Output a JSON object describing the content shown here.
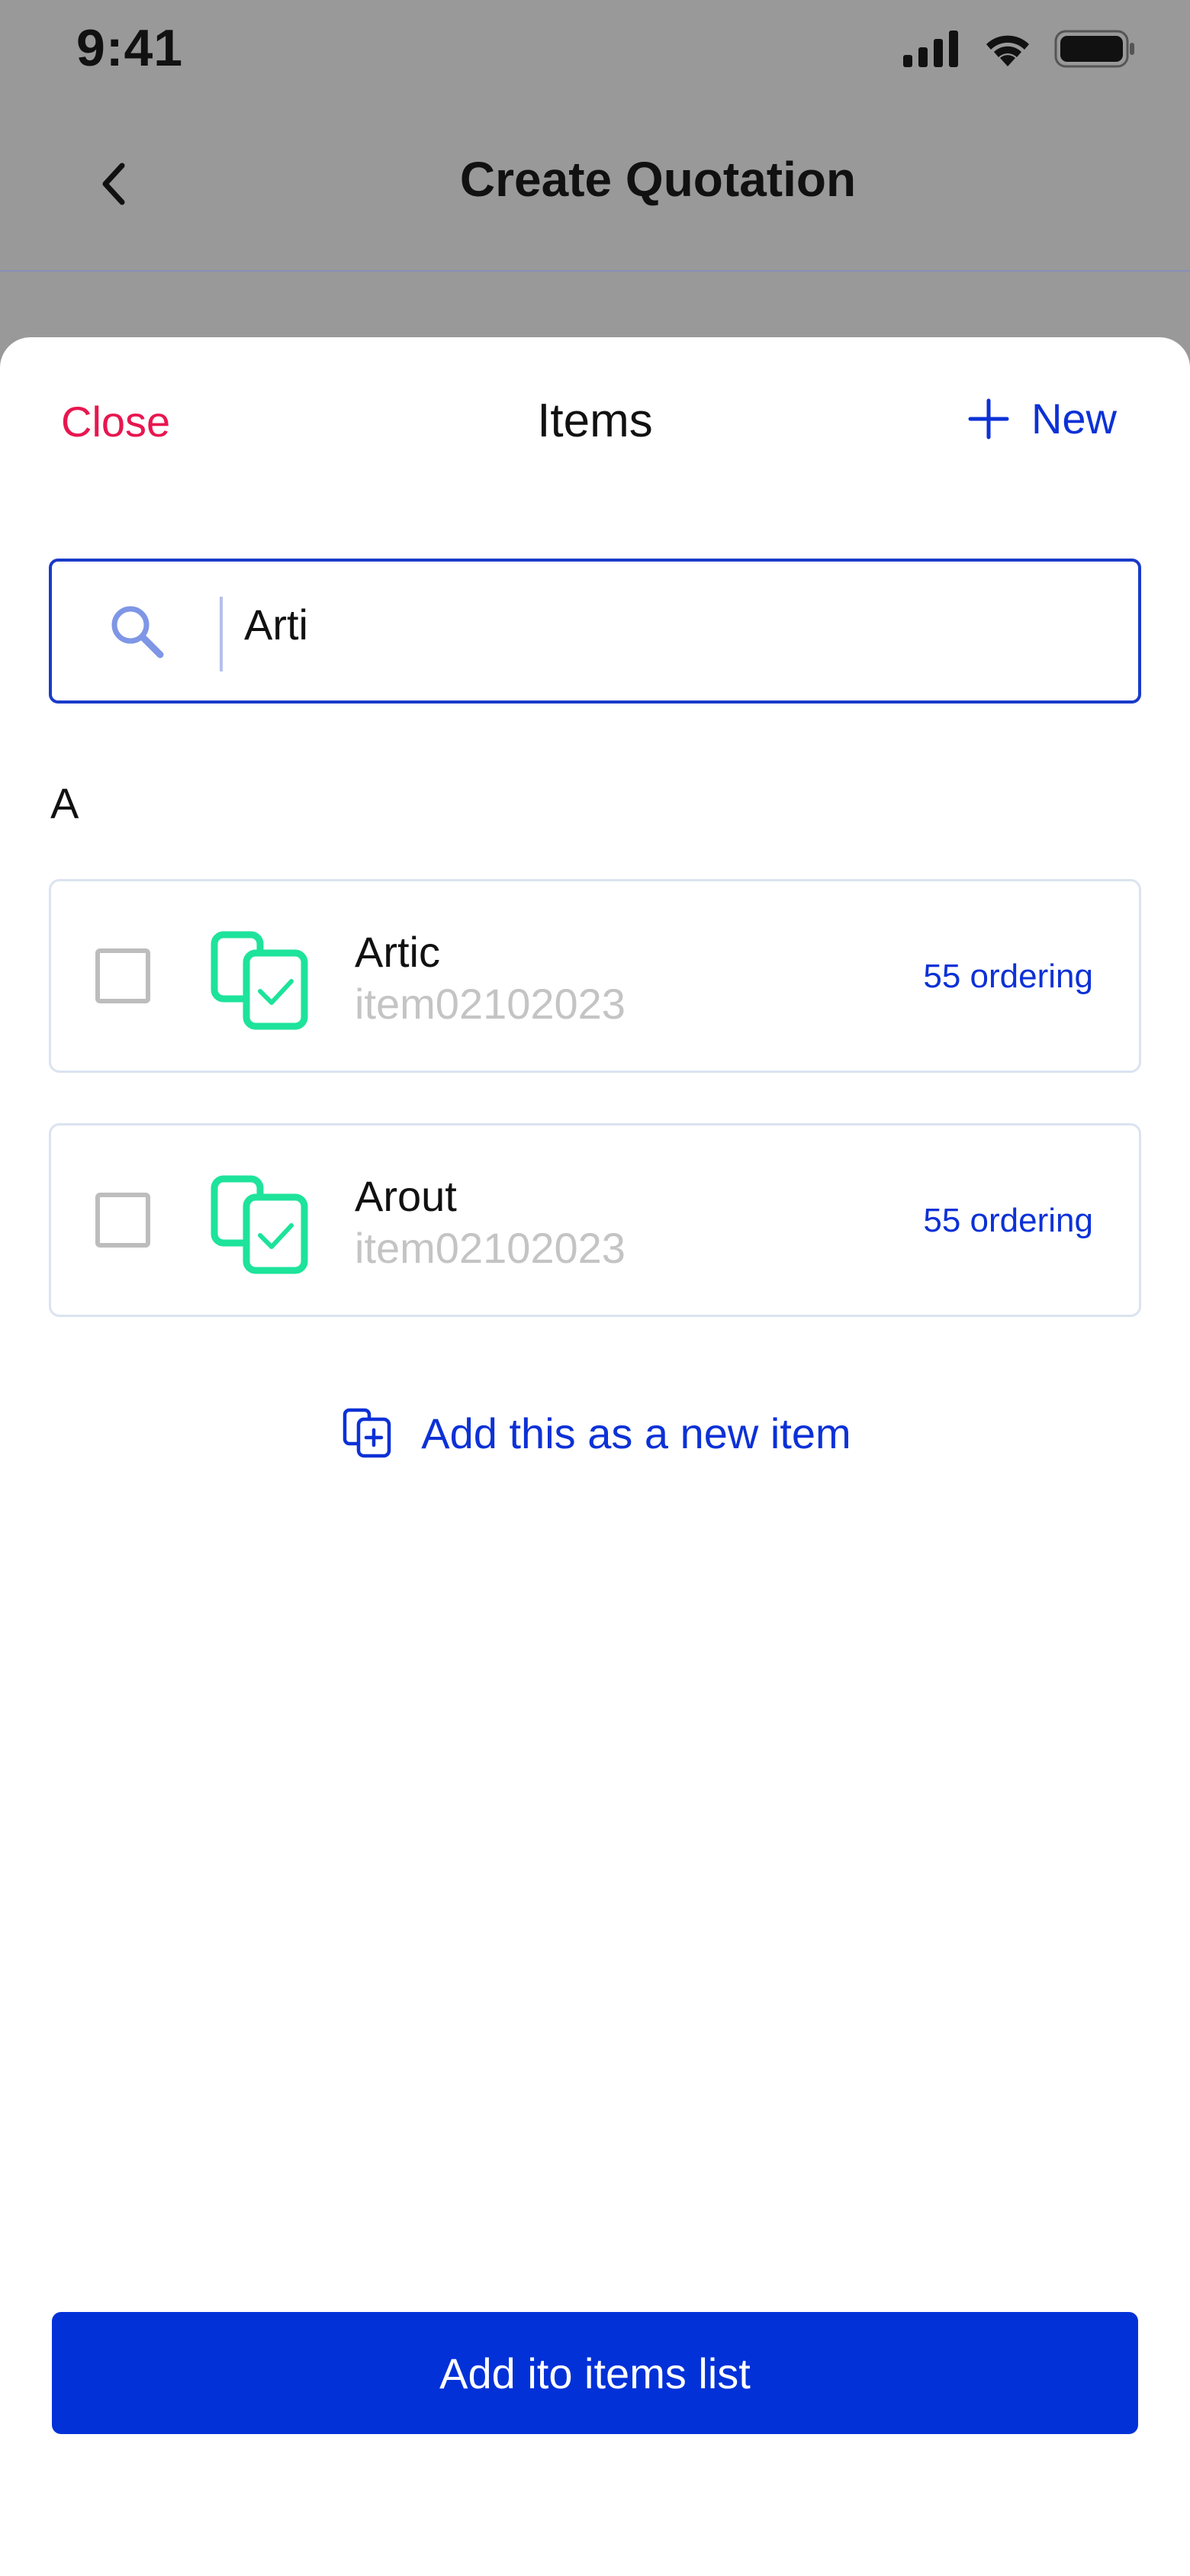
{
  "status_bar": {
    "time": "9:41"
  },
  "nav": {
    "title": "Create Quotation"
  },
  "sheet": {
    "close_label": "Close",
    "title": "Items",
    "new_label": "New",
    "search": {
      "value": "Arti"
    },
    "section_letter": "A",
    "items": [
      {
        "name": "Artic",
        "code": "item02102023",
        "meta": "55 ordering",
        "checked": false
      },
      {
        "name": "Arout",
        "code": "item02102023",
        "meta": "55 ordering",
        "checked": false
      }
    ],
    "add_new_item_label": "Add this as a new item",
    "primary_button_label": "Add ito items list"
  },
  "colors": {
    "accent": "#0C31D6",
    "danger": "#E8164F",
    "item_icon": "#1DE39B",
    "primary_button": "#0231D8",
    "overlay": "#999999"
  },
  "icons": [
    "signal-icon",
    "wifi-icon",
    "battery-icon",
    "back-icon",
    "plus-icon",
    "search-icon",
    "item-copy-check-icon",
    "add-copy-icon"
  ]
}
